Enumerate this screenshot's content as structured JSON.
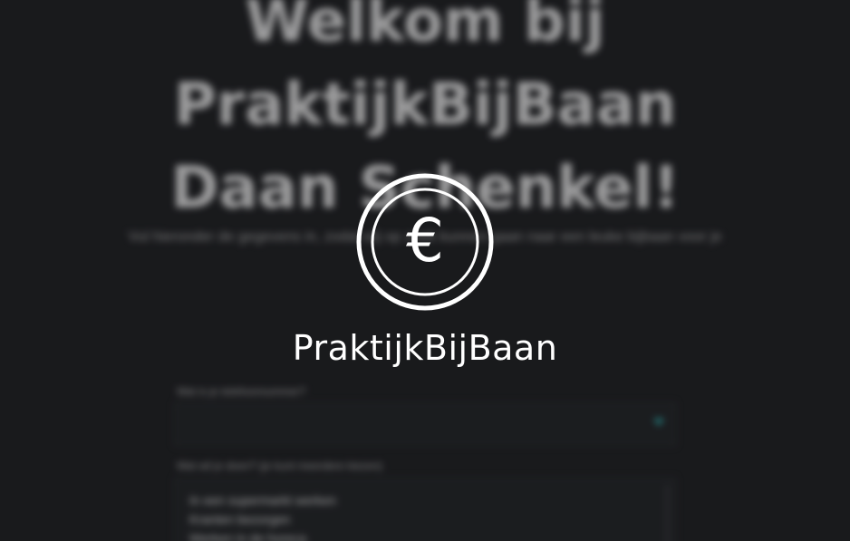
{
  "background": {
    "heading": "Welkom bij PraktijkBijBaan Daan Schenkel!",
    "intro": "Vul hieronder de gegevens in, zodat wij op zoek kunnen gaan naar een leuke bijbaan voor je",
    "phone_label": "Wat is je telefoonnummer?",
    "phone_value": "",
    "work_label": "Wat wil je doen? (je kunt meerdere kiezen)",
    "work_options": [
      "In een supermarkt werken",
      "Kranten bezorgen",
      "Werken in de horeca"
    ]
  },
  "splash": {
    "logo_symbol": "€",
    "logo_icon": "euro-coin-icon",
    "brand_name": "PraktijkBijBaan"
  },
  "colors": {
    "background": "#1b1c1e",
    "text": "#ffffff",
    "accent": "#2aa3a3"
  }
}
